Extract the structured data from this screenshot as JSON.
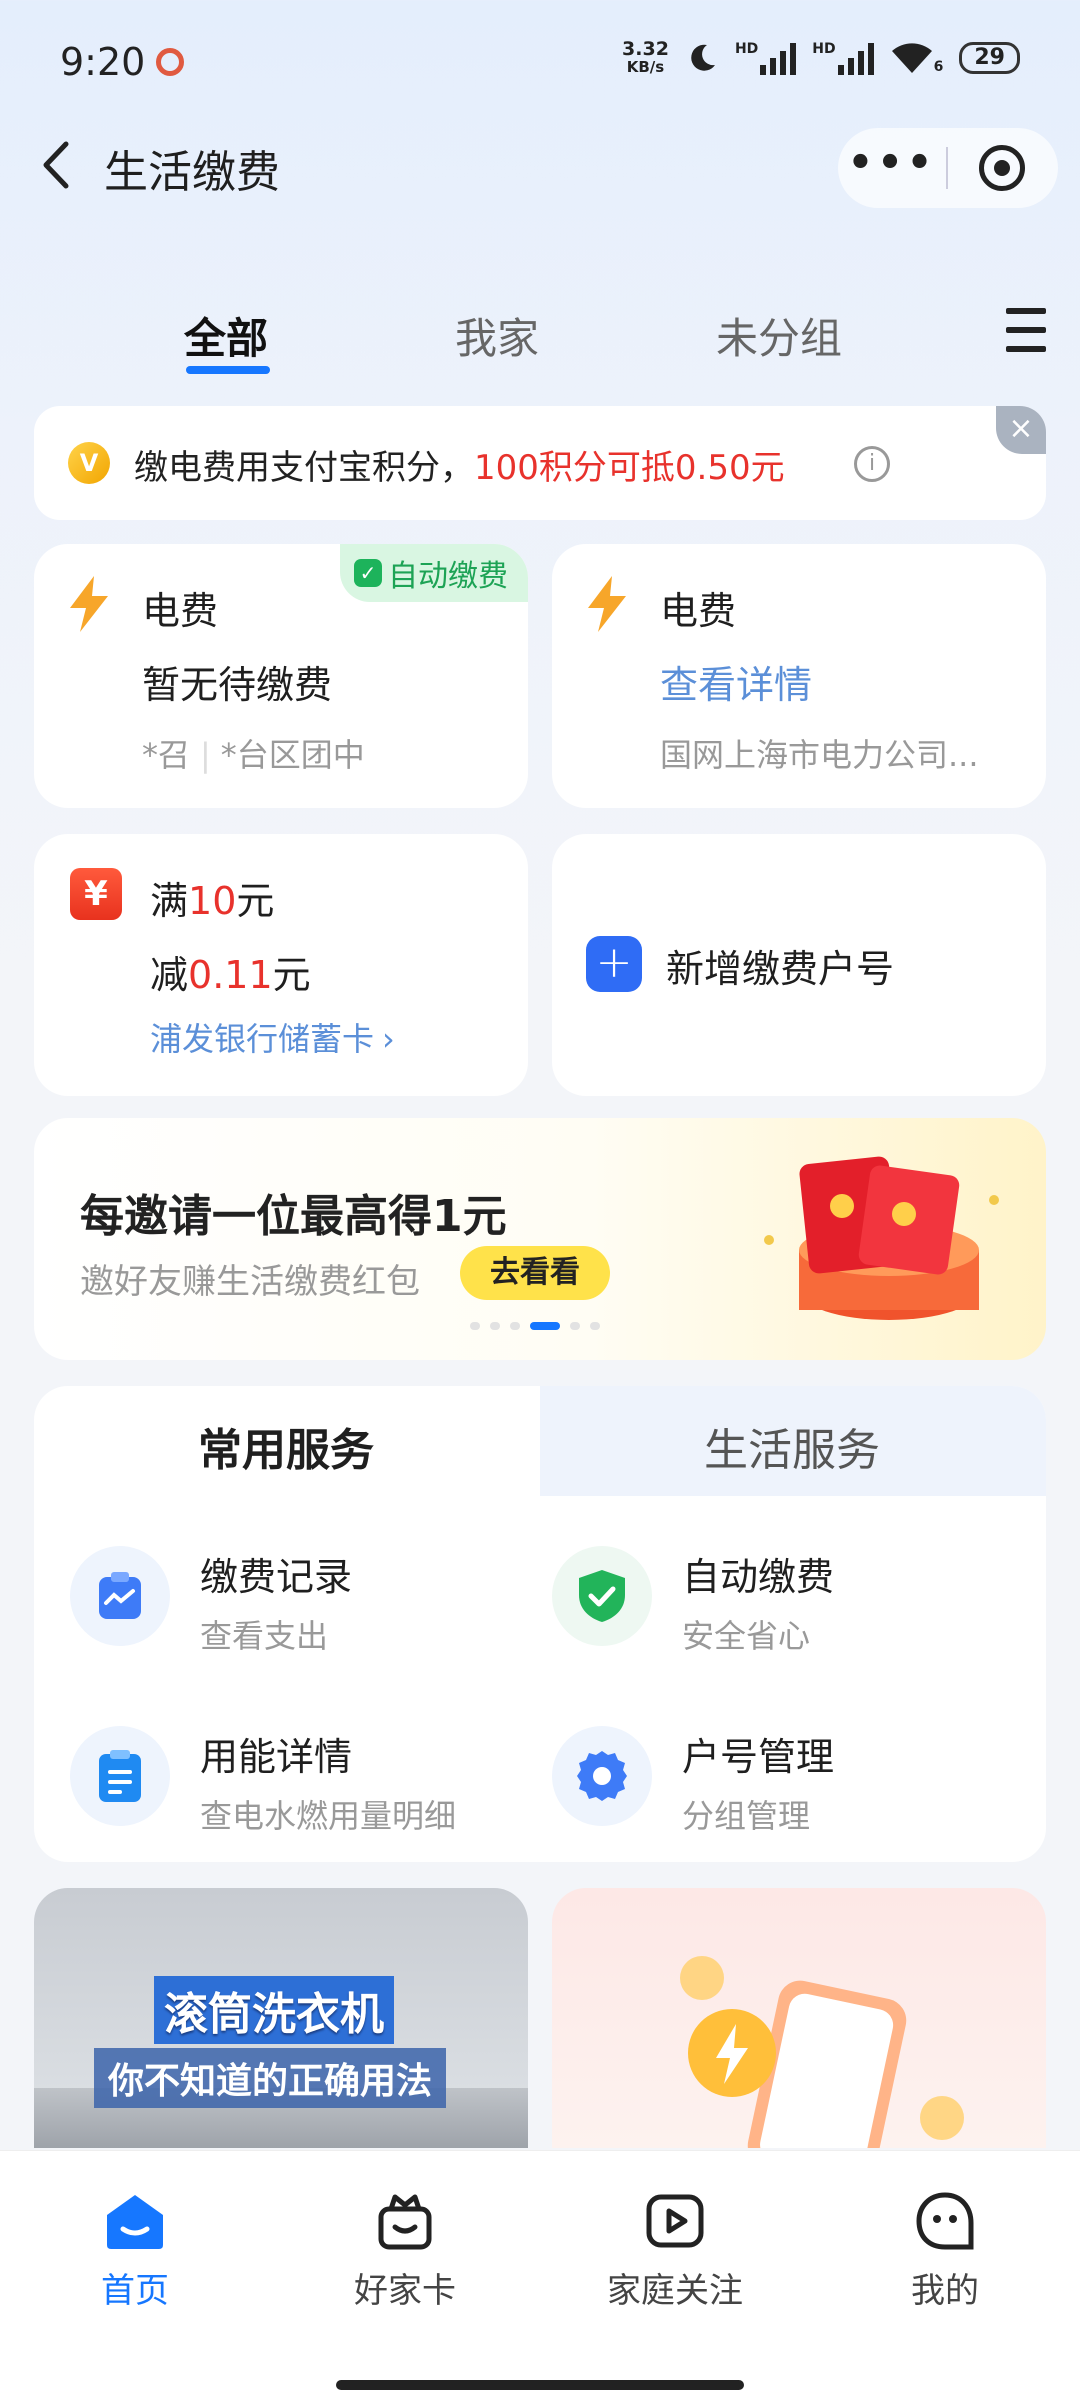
{
  "status_bar": {
    "time": "9:20",
    "net_speed_value": "3.32",
    "net_speed_unit": "KB/s",
    "network_1": "HD",
    "network_2": "HD",
    "wifi_level": "6",
    "battery": "29"
  },
  "header": {
    "title": "生活缴费",
    "more_label": "•••"
  },
  "tabs": [
    {
      "label": "全部",
      "active": true
    },
    {
      "label": "我家"
    },
    {
      "label": "未分组"
    }
  ],
  "points_banner": {
    "prefix": "缴电费用支付宝积分，",
    "highlight": "100积分可抵0.50元",
    "coin_glyph": "V",
    "info_glyph": "i",
    "close_glyph": "×"
  },
  "bill_cards": [
    {
      "title": "电费",
      "status": "暂无待缴费",
      "meta_1": "*召",
      "meta_2": "*台区团中",
      "badge": "自动缴费"
    },
    {
      "title": "电费",
      "status": "查看详情",
      "meta": "国网上海市电力公司..."
    }
  ],
  "promo_card": {
    "line1_prefix": "满",
    "line1_amount": "10",
    "line1_suffix": "元",
    "line2_prefix": "减",
    "line2_amount": "0.11",
    "line2_suffix": "元",
    "bank": "浦发银行储蓄卡",
    "chevron": "›",
    "icon_glyph": "¥"
  },
  "add_account": {
    "label": "新增缴费户号",
    "icon_glyph": "+"
  },
  "invite": {
    "title": "每邀请一位最高得1元",
    "subtitle": "邀好友赚生活缴费红包",
    "button": "去看看",
    "active_dot": 3,
    "dot_count": 6
  },
  "services": {
    "tabs": [
      "常用服务",
      "生活服务"
    ],
    "items": [
      {
        "name": "缴费记录",
        "desc": "查看支出",
        "icon": "clipboard-chart-icon"
      },
      {
        "name": "自动缴费",
        "desc": "安全省心",
        "icon": "shield-check-icon"
      },
      {
        "name": "用能详情",
        "desc": "查电水燃用量明细",
        "icon": "document-icon"
      },
      {
        "name": "户号管理",
        "desc": "分组管理",
        "icon": "gear-icon"
      }
    ]
  },
  "content_tiles": {
    "left_title": "滚筒洗衣机",
    "left_subtitle": "你不知道的正确用法"
  },
  "bottom_nav": [
    {
      "label": "首页",
      "icon": "home-icon",
      "active": true
    },
    {
      "label": "好家卡",
      "icon": "gift-icon"
    },
    {
      "label": "家庭关注",
      "icon": "video-icon"
    },
    {
      "label": "我的",
      "icon": "profile-icon"
    }
  ],
  "colors": {
    "accent": "#1677ff",
    "highlight_red": "#e8322c",
    "success_green": "#1da355",
    "link_blue": "#5b8fd8"
  }
}
